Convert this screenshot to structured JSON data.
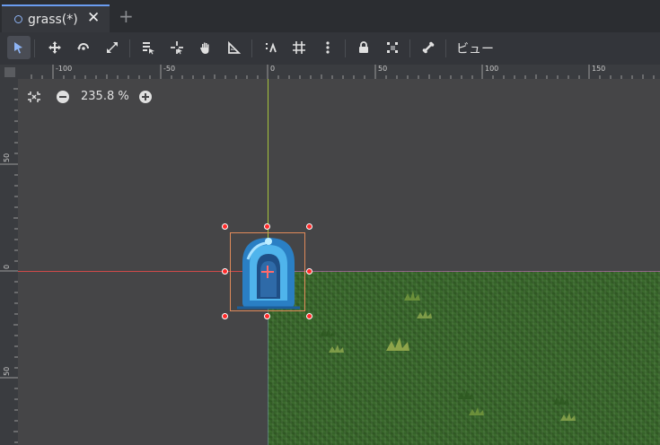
{
  "tabs": [
    {
      "label": "grass(*)",
      "modified": true
    }
  ],
  "toolbar": {
    "view_label": "ビュー",
    "tools": [
      "select-tool",
      "move-tool",
      "rotate-tool",
      "scale-tool",
      "list-select-tool",
      "pivot-tool",
      "pan-tool",
      "ruler-tool",
      "smart-snap",
      "grid-snap",
      "snap-options",
      "lock",
      "group",
      "skeleton"
    ]
  },
  "ruler": {
    "top_labels": [
      "-100",
      "-50",
      "0",
      "50",
      "100",
      "150"
    ],
    "left_labels": [
      "50",
      "0",
      "50"
    ]
  },
  "viewport": {
    "zoom_label": "235.8 %"
  },
  "colors": {
    "accent": "#6a9cf0",
    "x_axis": "#cf4a4a",
    "y_axis": "#a6c43d",
    "selection": "#e08a5a",
    "handle": "#ff2a2a",
    "grass": "#3b6a2d"
  }
}
